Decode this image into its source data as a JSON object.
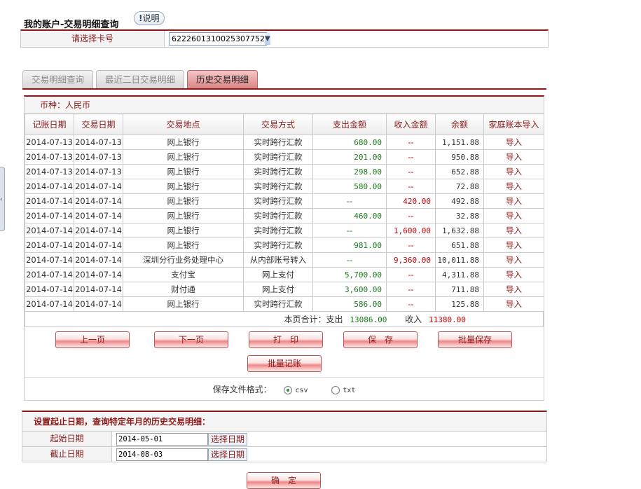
{
  "header": {
    "title": "我的账户-交易明细查询",
    "help": "说明",
    "card_label": "请选择卡号",
    "card_number": "6222601310025307752"
  },
  "tabs": [
    {
      "label": "交易明细查询",
      "active": false
    },
    {
      "label": "最近二日交易明细",
      "active": false
    },
    {
      "label": "历史交易明细",
      "active": true
    }
  ],
  "currency": "币种：人民币",
  "columns": [
    "记账日期",
    "交易日期",
    "交易地点",
    "交易方式",
    "支出金额",
    "收入金额",
    "余额",
    "家庭账本导入"
  ],
  "rows": [
    [
      "2014-07-13",
      "2014-07-13",
      "网上银行",
      "实时跨行汇款",
      "680.00",
      "--",
      "1,151.88",
      "导入"
    ],
    [
      "2014-07-13",
      "2014-07-13",
      "网上银行",
      "实时跨行汇款",
      "201.00",
      "--",
      "950.88",
      "导入"
    ],
    [
      "2014-07-13",
      "2014-07-13",
      "网上银行",
      "实时跨行汇款",
      "298.00",
      "--",
      "652.88",
      "导入"
    ],
    [
      "2014-07-14",
      "2014-07-14",
      "网上银行",
      "实时跨行汇款",
      "580.00",
      "--",
      "72.88",
      "导入"
    ],
    [
      "2014-07-14",
      "2014-07-14",
      "网上银行",
      "实时跨行汇款",
      "--",
      "420.00",
      "492.88",
      "导入"
    ],
    [
      "2014-07-14",
      "2014-07-14",
      "网上银行",
      "实时跨行汇款",
      "460.00",
      "--",
      "32.88",
      "导入"
    ],
    [
      "2014-07-14",
      "2014-07-14",
      "网上银行",
      "实时跨行汇款",
      "--",
      "1,600.00",
      "1,632.88",
      "导入"
    ],
    [
      "2014-07-14",
      "2014-07-14",
      "网上银行",
      "实时跨行汇款",
      "981.00",
      "--",
      "651.88",
      "导入"
    ],
    [
      "2014-07-14",
      "2014-07-14",
      "深圳分行业务处理中心",
      "从内部账号转入",
      "--",
      "9,360.00",
      "10,011.88",
      "导入"
    ],
    [
      "2014-07-14",
      "2014-07-14",
      "支付宝",
      "网上支付",
      "5,700.00",
      "--",
      "4,311.88",
      "导入"
    ],
    [
      "2014-07-14",
      "2014-07-14",
      "财付通",
      "网上支付",
      "3,600.00",
      "--",
      "711.88",
      "导入"
    ],
    [
      "2014-07-14",
      "2014-07-14",
      "网上银行",
      "实时跨行汇款",
      "586.00",
      "--",
      "125.88",
      "导入"
    ]
  ],
  "summary": {
    "label": "本页合计：支出",
    "expense": "13086.00",
    "income_label": "收入",
    "income": "11380.00"
  },
  "buttons": {
    "prev": "上一页",
    "next": "下一页",
    "print": "打　印",
    "save": "保　存",
    "batch_save": "批量保存",
    "batch_post": "批量记账",
    "confirm": "确　定"
  },
  "format": {
    "label": "保存文件格式：",
    "options": [
      {
        "label": "csv",
        "selected": true
      },
      {
        "label": "txt",
        "selected": false
      }
    ]
  },
  "date_query": {
    "title": "设置起止日期，查询特定年月的历史交易明细：",
    "start_label": "起始日期",
    "start_value": "2014-05-01",
    "end_label": "截止日期",
    "end_value": "2014-08-03",
    "pick_label": "选择日期"
  },
  "colors": {
    "accent": "#8b1a1a",
    "expense": "#1d7a1d",
    "income": "#cc0000"
  }
}
